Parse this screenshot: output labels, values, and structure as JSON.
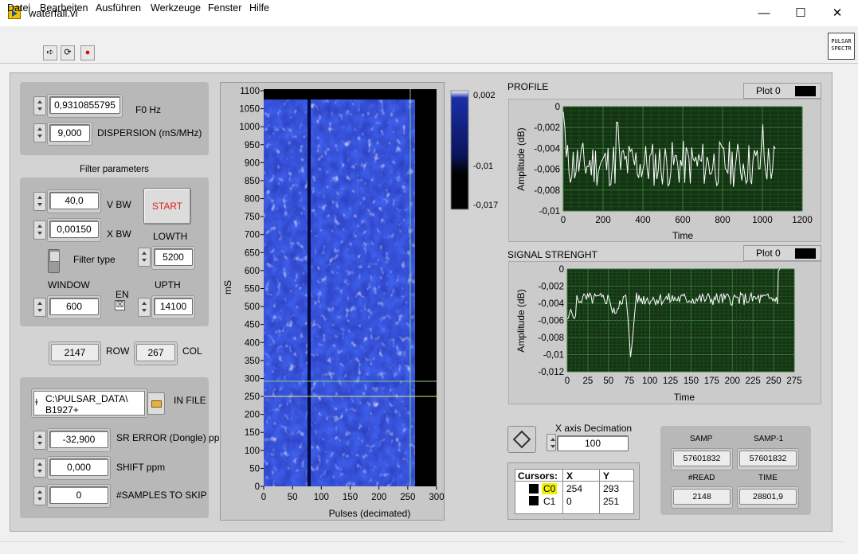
{
  "window": {
    "title": "waterfall.vi",
    "minimize": "—",
    "maximize": "☐",
    "close": "✕"
  },
  "menu": [
    "Datei",
    "Bearbeiten",
    "Ausführen",
    "Werkzeuge",
    "Fenster",
    "Hilfe"
  ],
  "toolbar": {
    "run": "➪",
    "run_continuous": "⟳",
    "abort": "●"
  },
  "corner_logo": {
    "line1": "PULSAR",
    "line2": "SPECTR"
  },
  "controls": {
    "f0": {
      "value": "0,9310855795",
      "label": "F0 Hz"
    },
    "dispersion": {
      "value": "9,000",
      "label": "DISPERSION (mS/MHz)"
    },
    "filter_title": "Filter parameters",
    "vbw": {
      "value": "40,0",
      "label": "V BW"
    },
    "xbw": {
      "value": "0,00150",
      "label": "X BW"
    },
    "start": "START",
    "lowth": {
      "value": "5200",
      "label": "LOWTH"
    },
    "filter_type": "Filter type",
    "window": {
      "value": "600",
      "label": "WINDOW"
    },
    "en": {
      "label": "EN",
      "checked": "☒"
    },
    "upth": {
      "value": "14100",
      "label": "UPTH"
    },
    "row": {
      "value": "2147",
      "label": "ROW"
    },
    "col": {
      "value": "267",
      "label": "COL"
    },
    "infile": {
      "line1": "C:\\PULSAR_DATA\\",
      "line2": "B1927+",
      "label": "IN FILE",
      "path_icon": "ɫ"
    },
    "sr_error": {
      "value": "-32,900",
      "label": "SR ERROR (Dongle) ppm"
    },
    "shift": {
      "value": "0,000",
      "label": "SHIFT ppm"
    },
    "skip": {
      "value": "0",
      "label": "#SAMPLES TO SKIP"
    }
  },
  "waterfall": {
    "y_ticks": [
      "1100",
      "1050",
      "1000",
      "950",
      "900",
      "850",
      "800",
      "750",
      "700",
      "650",
      "600",
      "550",
      "500",
      "450",
      "400",
      "350",
      "300",
      "250",
      "200",
      "150",
      "100",
      "50",
      "0"
    ],
    "x_ticks": [
      "0",
      "50",
      "100",
      "150",
      "200",
      "250",
      "300"
    ],
    "xlabel": "Pulses (decimated)",
    "ylabel": "mS",
    "scale": [
      "0,002",
      "-0,01",
      "-0,017"
    ],
    "colors": {
      "low": "#000000",
      "mid": "#1a2fa8",
      "high": "#ffffff"
    }
  },
  "profile": {
    "title": "PROFILE",
    "legend": "Plot 0",
    "xlabel": "Time",
    "ylabel": "Amplitude (dB)",
    "y_ticks": [
      "0",
      "-0,002",
      "-0,004",
      "-0,006",
      "-0,008",
      "-0,01"
    ],
    "x_ticks": [
      "0",
      "200",
      "400",
      "600",
      "800",
      "1000",
      "1200"
    ],
    "colors": {
      "bg": "#133313",
      "grid": "#2f6a2f",
      "trace": "#ffffff"
    }
  },
  "signal": {
    "title": "SIGNAL STRENGHT",
    "legend": "Plot 0",
    "xlabel": "Time",
    "ylabel": "Amplitude (dB)",
    "y_ticks": [
      "0",
      "-0,002",
      "-0,004",
      "-0,006",
      "-0,008",
      "-0,01",
      "-0,012"
    ],
    "x_ticks": [
      "0",
      "25",
      "50",
      "75",
      "100",
      "125",
      "150",
      "175",
      "200",
      "225",
      "250",
      "275"
    ]
  },
  "decimation": {
    "label": "X axis Decimation",
    "value": "100"
  },
  "cursors": {
    "header": [
      "Cursors:",
      "X",
      "Y"
    ],
    "rows": [
      {
        "name": "C0",
        "x": "254",
        "y": "293"
      },
      {
        "name": "C1",
        "x": "0",
        "y": "251"
      }
    ]
  },
  "stats": {
    "samp": {
      "label": "SAMP",
      "value": "57601832"
    },
    "samp1": {
      "label": "SAMP-1",
      "value": "57601832"
    },
    "read": {
      "label": "#READ",
      "value": "2148"
    },
    "time": {
      "label": "TIME",
      "value": "28801,9"
    }
  }
}
